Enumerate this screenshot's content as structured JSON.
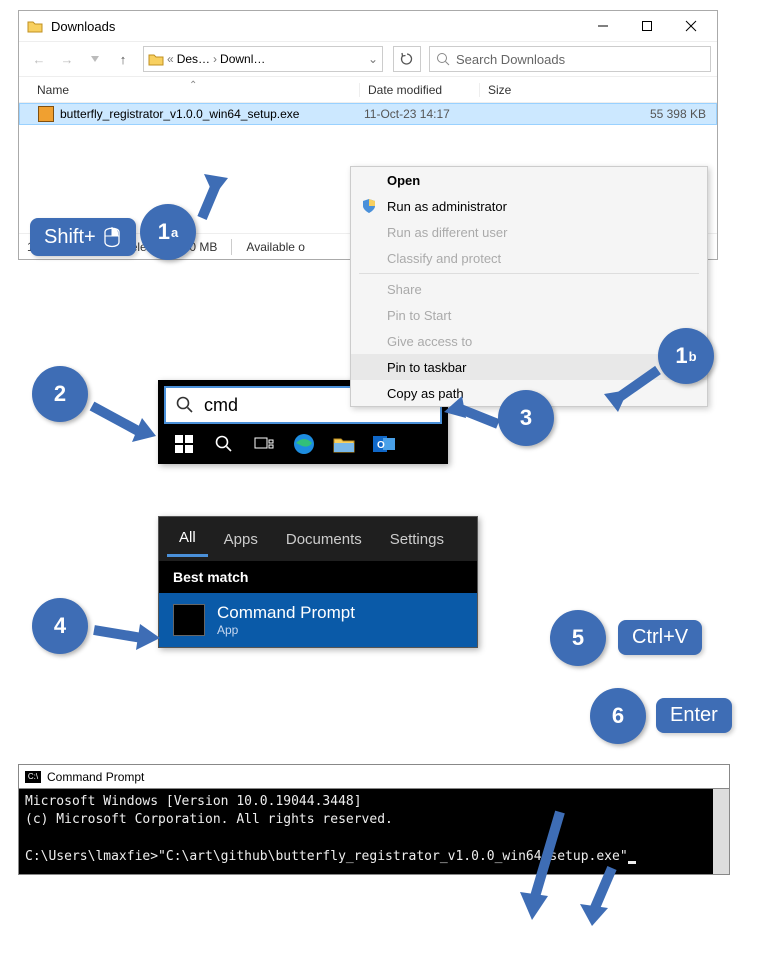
{
  "explorer": {
    "title": "Downloads",
    "breadcrumb1": "Des…",
    "breadcrumb2": "Downl…",
    "search_placeholder": "Search Downloads",
    "columns": {
      "name": "Name",
      "date": "Date modified",
      "size": "Size"
    },
    "file": {
      "name": "butterfly_registrator_v1.0.0_win64_setup.exe",
      "date": "11-Oct-23 14:17",
      "size": "55 398 KB"
    },
    "status": {
      "count": "1 item",
      "selected": "1 item selected  54.0 MB",
      "avail": "Available o"
    }
  },
  "contextmenu": {
    "open": "Open",
    "runadmin": "Run as administrator",
    "rundiff": "Run as different user",
    "classify": "Classify and protect",
    "share": "Share",
    "pinstart": "Pin to Start",
    "giveaccess": "Give access to",
    "pintaskbar": "Pin to taskbar",
    "copypath": "Copy as path"
  },
  "step1a_label": "Shift+",
  "step1a_num": "1",
  "step1a_sup": "a",
  "step1b_num": "1",
  "step1b_sup": "b",
  "step2": "2",
  "step3": "3",
  "step4": "4",
  "step5": "5",
  "step5_label": "Ctrl+V",
  "step6": "6",
  "step6_label": "Enter",
  "taskbar_search": "cmd",
  "searchres": {
    "tab_all": "All",
    "tab_apps": "Apps",
    "tab_docs": "Documents",
    "tab_settings": "Settings",
    "bestmatch": "Best match",
    "result_title": "Command Prompt",
    "result_sub": "App"
  },
  "cmd": {
    "title": "Command Prompt",
    "line1": "Microsoft Windows [Version 10.0.19044.3448]",
    "line2": "(c) Microsoft Corporation. All rights reserved.",
    "prompt": "C:\\Users\\lmaxfie>\"C:\\art\\github\\butterfly_registrator_v1.0.0_win64_setup.exe\""
  }
}
